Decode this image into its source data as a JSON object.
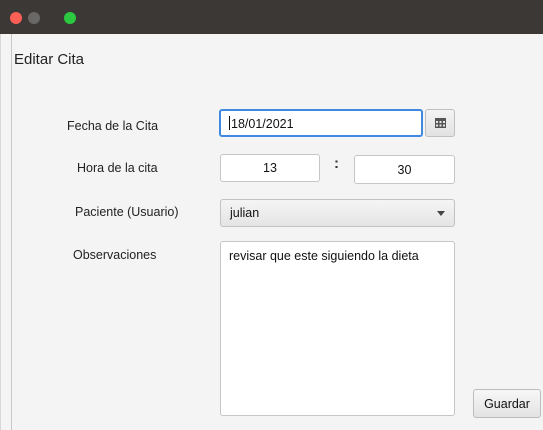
{
  "window": {
    "title": "Editar Cita"
  },
  "form": {
    "fecha": {
      "label": "Fecha de la Cita",
      "value": "18/01/2021",
      "picker_icon": "calendar-icon"
    },
    "hora": {
      "label": "Hora de la cita",
      "hour": "13",
      "separator": ":",
      "minute": "30"
    },
    "paciente": {
      "label": "Paciente (Usuario)",
      "selected": "julian",
      "arrow_icon": "chevron-down-icon"
    },
    "observaciones": {
      "label": "Observaciones",
      "value": "revisar que este siguiendo la dieta"
    },
    "save_label": "Guardar"
  },
  "colors": {
    "focus_border": "#3f8ae0",
    "close": "#fe5f57",
    "minimize": "#6a6866",
    "maximize": "#2bc840"
  }
}
